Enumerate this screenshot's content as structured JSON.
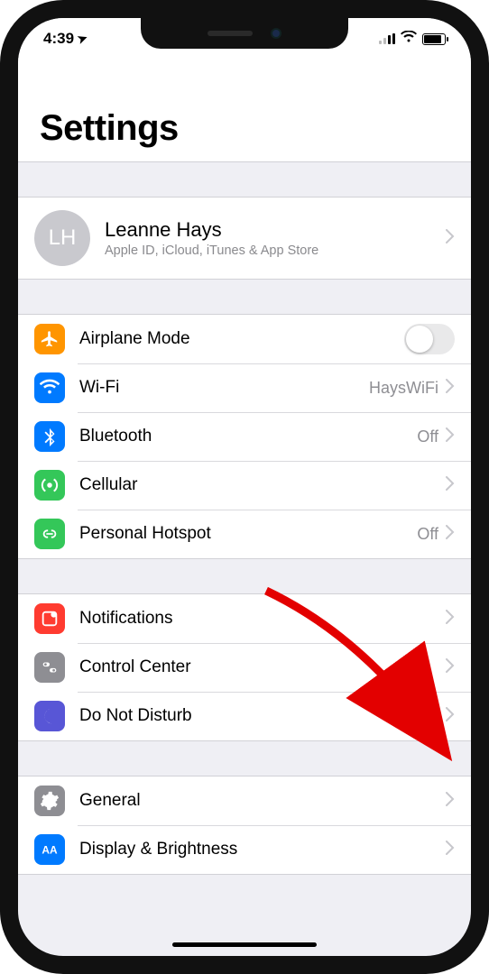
{
  "status": {
    "time": "4:39",
    "location_glyph": "➤"
  },
  "header": {
    "title": "Settings"
  },
  "profile": {
    "initials": "LH",
    "name": "Leanne Hays",
    "subtitle": "Apple ID, iCloud, iTunes & App Store"
  },
  "group1": {
    "airplane": {
      "label": "Airplane Mode"
    },
    "wifi": {
      "label": "Wi-Fi",
      "value": "HaysWiFi"
    },
    "bluetooth": {
      "label": "Bluetooth",
      "value": "Off"
    },
    "cellular": {
      "label": "Cellular"
    },
    "hotspot": {
      "label": "Personal Hotspot",
      "value": "Off"
    }
  },
  "group2": {
    "notifications": {
      "label": "Notifications"
    },
    "controlcenter": {
      "label": "Control Center"
    },
    "dnd": {
      "label": "Do Not Disturb"
    }
  },
  "group3": {
    "general": {
      "label": "General"
    },
    "display": {
      "label": "Display & Brightness"
    }
  },
  "colors": {
    "airplane": "#ff9500",
    "wifi": "#007aff",
    "bluetooth": "#007aff",
    "cellular": "#34c759",
    "hotspot": "#34c759",
    "notifications": "#ff3b30",
    "controlcenter": "#8e8e93",
    "dnd": "#5856d6",
    "general": "#8e8e93",
    "display": "#007aff"
  }
}
